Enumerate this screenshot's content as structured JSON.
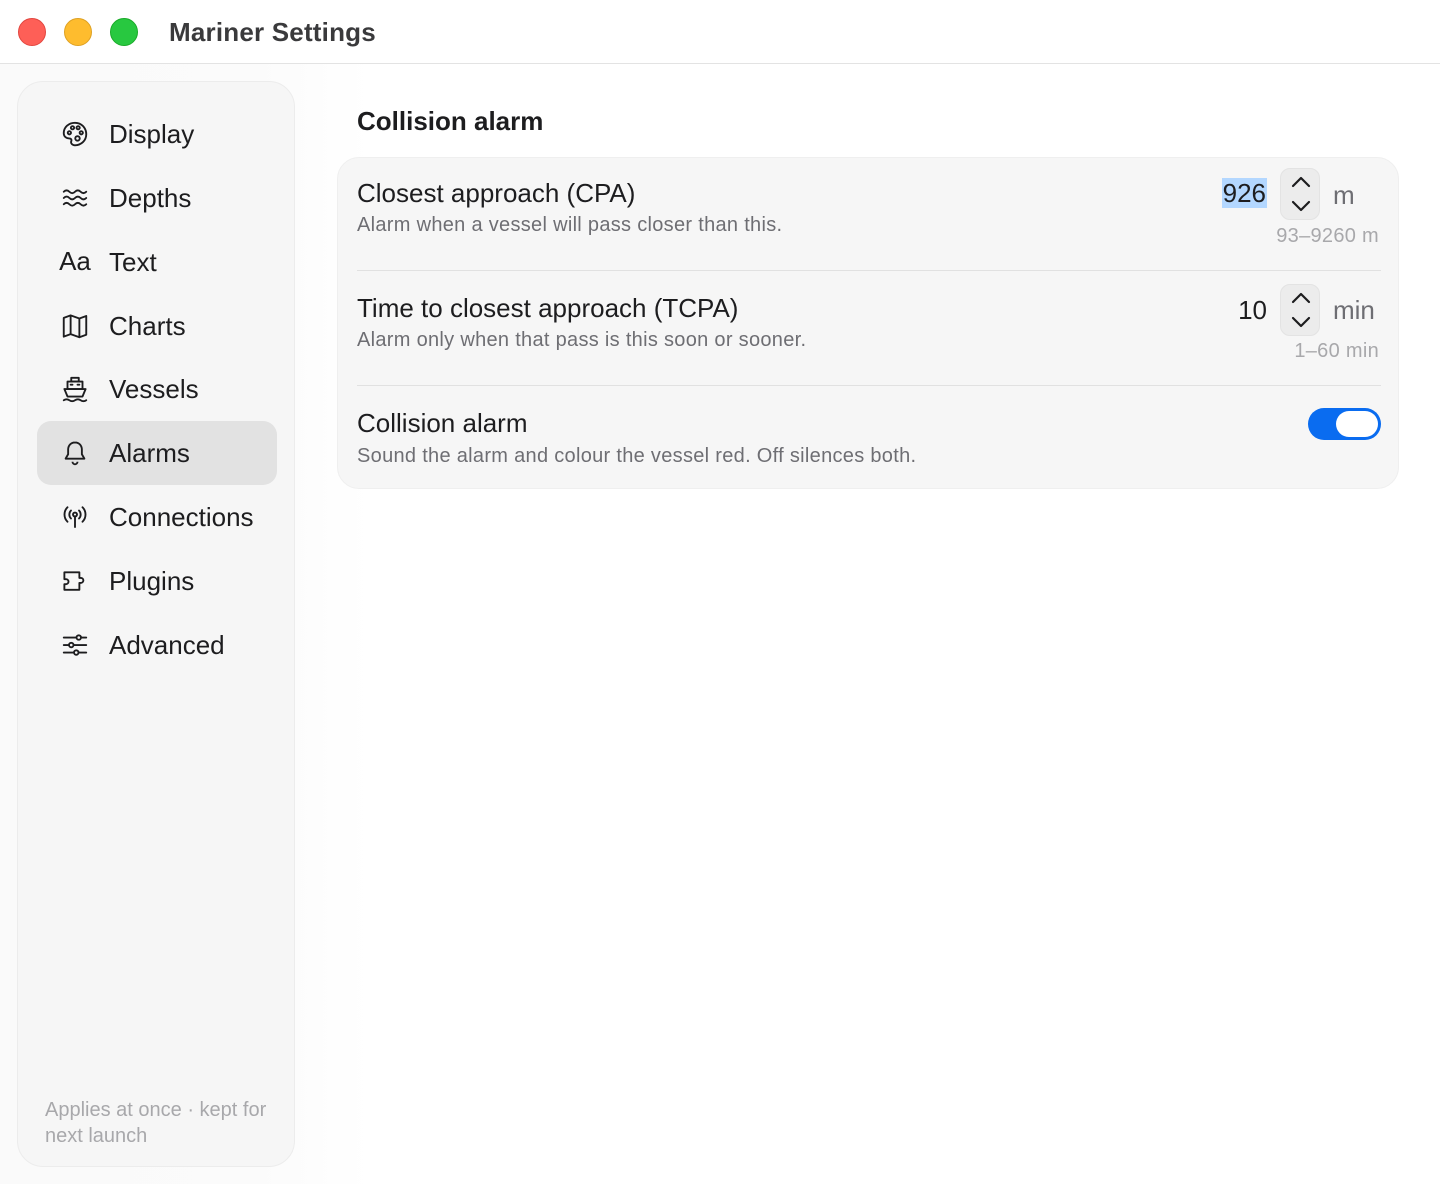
{
  "window": {
    "title": "Mariner Settings"
  },
  "sidebar": {
    "items": [
      {
        "label": "Display",
        "icon": "palette-icon",
        "active": false
      },
      {
        "label": "Depths",
        "icon": "waves-icon",
        "active": false
      },
      {
        "label": "Text",
        "icon": "text-icon",
        "active": false
      },
      {
        "label": "Charts",
        "icon": "map-icon",
        "active": false
      },
      {
        "label": "Vessels",
        "icon": "ship-icon",
        "active": false
      },
      {
        "label": "Alarms",
        "icon": "bell-icon",
        "active": true
      },
      {
        "label": "Connections",
        "icon": "antenna-icon",
        "active": false
      },
      {
        "label": "Plugins",
        "icon": "plugin-icon",
        "active": false
      },
      {
        "label": "Advanced",
        "icon": "sliders-icon",
        "active": false
      }
    ],
    "text_icon_glyph": "Aa",
    "footer": "Applies at once · kept for next launch"
  },
  "main": {
    "section_title": "Collision alarm",
    "rows": [
      {
        "title": "Closest approach (CPA)",
        "description": "Alarm when a vessel will pass closer than this.",
        "value": "926",
        "unit": "m",
        "range": "93–9260 m",
        "value_selected": true
      },
      {
        "title": "Time to closest approach (TCPA)",
        "description": "Alarm only when that pass is this soon or sooner.",
        "value": "10",
        "unit": "min",
        "range": "1–60 min",
        "value_selected": false
      },
      {
        "title": "Collision alarm",
        "description": "Sound the alarm and colour the vessel red. Off silences both.",
        "toggle_on": true
      }
    ]
  },
  "colors": {
    "accent": "#0a6cf0",
    "selection": "#b3d7ff",
    "close": "#fe5f57",
    "minimize": "#febc2e",
    "zoom": "#28c840"
  }
}
